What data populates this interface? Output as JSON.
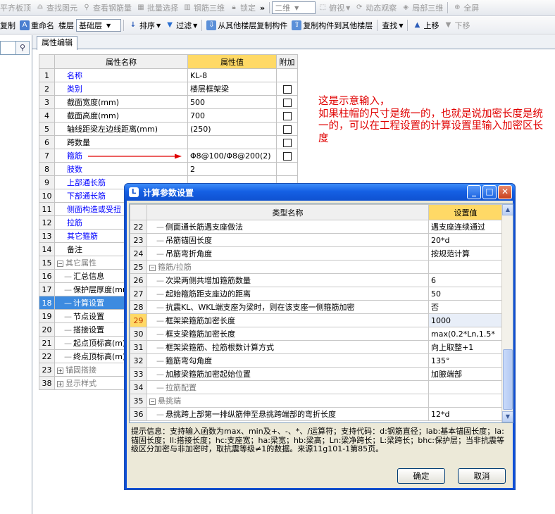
{
  "toolbar1": {
    "items": [
      {
        "label": "平齐板顶",
        "icon": "align-icon",
        "disabled": true
      },
      {
        "label": "查找图元",
        "icon": "binoculars-icon",
        "disabled": true
      },
      {
        "label": "查看钢筋量",
        "icon": "magnifier-icon",
        "disabled": true
      },
      {
        "label": "批量选择",
        "icon": "batch-select-icon",
        "disabled": true
      },
      {
        "label": "钢筋三维",
        "icon": "rebar-3d-icon",
        "disabled": true
      },
      {
        "label": "锁定",
        "icon": "lock-icon",
        "disabled": true
      }
    ],
    "overflow": "»",
    "view_select": "二维",
    "view_buttons": [
      {
        "label": "俯视",
        "icon": "top-view-icon"
      },
      {
        "label": "动态观察",
        "icon": "orbit-icon"
      },
      {
        "label": "局部三维",
        "icon": "local-3d-icon"
      },
      {
        "label": "全屏",
        "icon": "fullscreen-icon"
      }
    ]
  },
  "toolbar2": {
    "copy_label": "复制",
    "rename_label": "重命名",
    "floor_label": "楼层",
    "floor_value": "基础层",
    "sort_label": "排序",
    "filter_label": "过滤",
    "copy_from_label": "从其他楼层复制构件",
    "copy_to_label": "复制构件到其他楼层",
    "find_label": "查找",
    "up_label": "上移",
    "down_label": "下移"
  },
  "tab": {
    "label": "属性编辑"
  },
  "properties": {
    "headers": {
      "name": "属性名称",
      "value": "属性值",
      "extra": "附加"
    },
    "rows": [
      {
        "n": "1",
        "name": "名称",
        "value": "KL-8",
        "style": "blue",
        "cb": false
      },
      {
        "n": "2",
        "name": "类别",
        "value": "楼层框架梁",
        "style": "blue",
        "cb": true
      },
      {
        "n": "3",
        "name": "截面宽度(mm)",
        "value": "500",
        "style": "",
        "cb": true
      },
      {
        "n": "4",
        "name": "截面高度(mm)",
        "value": "700",
        "style": "",
        "cb": true
      },
      {
        "n": "5",
        "name": "轴线距梁左边线距离(mm)",
        "value": "(250)",
        "style": "",
        "cb": true
      },
      {
        "n": "6",
        "name": "跨数量",
        "value": "",
        "style": "",
        "cb": true
      },
      {
        "n": "7",
        "name": "箍筋",
        "value": "Φ8@100/Φ8@200(2)",
        "style": "blue",
        "cb": true
      },
      {
        "n": "8",
        "name": "肢数",
        "value": "2",
        "style": "blue",
        "cb": false
      },
      {
        "n": "9",
        "name": "上部通长筋",
        "value": "",
        "style": "blue",
        "cb": false
      },
      {
        "n": "10",
        "name": "下部通长筋",
        "value": "",
        "style": "blue",
        "cb": false
      },
      {
        "n": "11",
        "name": "侧面构造或受扭",
        "value": "",
        "style": "blue",
        "cb": false
      },
      {
        "n": "12",
        "name": "拉筋",
        "value": "",
        "style": "blue",
        "cb": false
      },
      {
        "n": "13",
        "name": "其它箍筋",
        "value": "",
        "style": "blue",
        "cb": false
      },
      {
        "n": "14",
        "name": "备注",
        "value": "",
        "style": "",
        "cb": false
      },
      {
        "n": "15",
        "name": "其它属性",
        "value": "",
        "style": "grey",
        "cb": false,
        "exp": "−"
      },
      {
        "n": "16",
        "name": "汇总信息",
        "value": "",
        "style": "",
        "cb": false,
        "child": true
      },
      {
        "n": "17",
        "name": "保护层厚度(mm)",
        "value": "",
        "style": "",
        "cb": false,
        "child": true
      },
      {
        "n": "18",
        "name": "计算设置",
        "value": "",
        "style": "",
        "cb": false,
        "child": true,
        "selected": true
      },
      {
        "n": "19",
        "name": "节点设置",
        "value": "",
        "style": "",
        "cb": false,
        "child": true
      },
      {
        "n": "20",
        "name": "搭接设置",
        "value": "",
        "style": "",
        "cb": false,
        "child": true
      },
      {
        "n": "21",
        "name": "起点顶标高(m)",
        "value": "",
        "style": "",
        "cb": false,
        "child": true
      },
      {
        "n": "22",
        "name": "终点顶标高(m)",
        "value": "",
        "style": "",
        "cb": false,
        "child": true
      },
      {
        "n": "23",
        "name": "锚固搭接",
        "value": "",
        "style": "grey",
        "cb": false,
        "exp": "+"
      },
      {
        "n": "38",
        "name": "显示样式",
        "value": "",
        "style": "grey",
        "cb": false,
        "exp": "+"
      }
    ]
  },
  "annotation": {
    "line1": "这是示意输入，",
    "line2": "如果柱帽的尺寸是统一的，也就是说加密长度是统一的，可以在工程设置的计算设置里输入加密区长度"
  },
  "annotation_color": "#e00000",
  "dialog": {
    "title": "计算参数设置",
    "headers": {
      "name": "类型名称",
      "value": "设置值"
    },
    "rows": [
      {
        "n": "22",
        "name": "侧面通长筋遇支座做法",
        "value": "遇支座连续通过"
      },
      {
        "n": "23",
        "name": "吊筋锚固长度",
        "value": "20*d"
      },
      {
        "n": "24",
        "name": "吊筋弯折角度",
        "value": "按规范计算"
      },
      {
        "n": "25",
        "name": "箍筋/拉筋",
        "value": "",
        "group": true
      },
      {
        "n": "26",
        "name": "次梁两侧共增加箍筋数量",
        "value": "6"
      },
      {
        "n": "27",
        "name": "起始箍筋距支座边的距离",
        "value": "50"
      },
      {
        "n": "28",
        "name": "抗震KL、WKL端支座为梁时，则在该支座一侧箍筋加密",
        "value": "否"
      },
      {
        "n": "29",
        "name": "框架梁箍筋加密长度",
        "value": "1000",
        "highlight": true
      },
      {
        "n": "30",
        "name": "框支梁箍筋加密长度",
        "value": "max(0.2*Ln,1.5*"
      },
      {
        "n": "31",
        "name": "框架梁箍筋、拉筋根数计算方式",
        "value": "向上取整+1"
      },
      {
        "n": "32",
        "name": "箍筋弯勾角度",
        "value": "135°"
      },
      {
        "n": "33",
        "name": "加腋梁箍筋加密起始位置",
        "value": "加腋端部"
      },
      {
        "n": "34",
        "name": "拉筋配置",
        "value": "",
        "greyname": true
      },
      {
        "n": "35",
        "name": "悬挑端",
        "value": "",
        "group": true
      },
      {
        "n": "36",
        "name": "悬挑跨上部第一排纵筋伸至悬挑跨端部的弯折长度",
        "value": "12*d"
      }
    ],
    "hint": "提示信息：支持输入函数为max、min及+、-、*、/运算符；支持代码：d:钢筋直径；lab:基本锚固长度；la:锚固长度；ll:搭接长度；hc:支座宽；ha:梁宽；hb:梁高；Ln:梁净跨长；L:梁跨长；bhc:保护层；当非抗震等级区分加密与非加密时，取抗震等级≠1的数据。来源11g101-1第85页。",
    "ok_label": "确定",
    "cancel_label": "取消"
  },
  "colors": {
    "accent": "#0f4fd6",
    "selected": "#3d8be0",
    "header_highlight": "#ffd966",
    "arrow": "#e00000"
  }
}
